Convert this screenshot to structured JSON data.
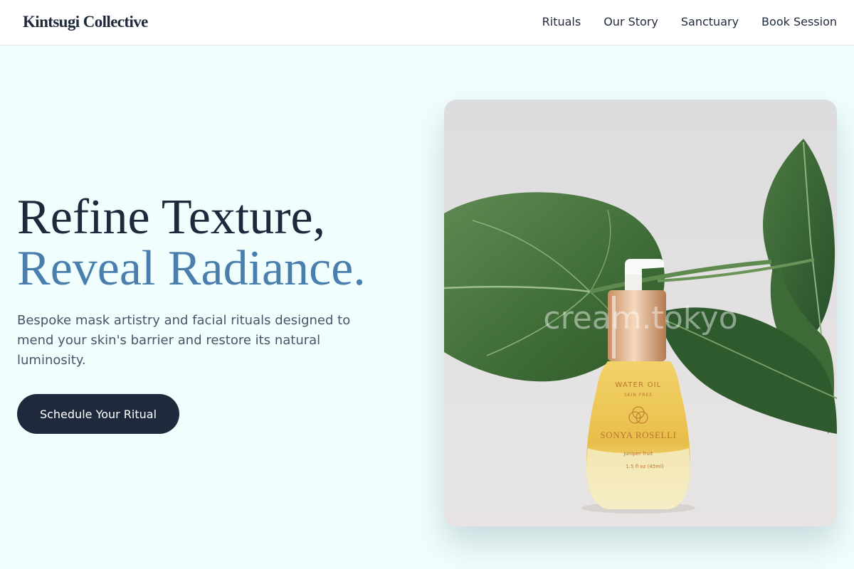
{
  "brand": {
    "name": "Kintsugi Collective"
  },
  "nav": {
    "items": [
      {
        "label": "Rituals"
      },
      {
        "label": "Our Story"
      },
      {
        "label": "Sanctuary"
      },
      {
        "label": "Book Session"
      }
    ]
  },
  "hero": {
    "title_line1": "Refine Texture,",
    "title_line2": "Reveal Radiance.",
    "subtitle": "Bespoke mask artistry and facial rituals designed to mend your skin's barrier and restore its natural luminosity.",
    "cta_label": "Schedule Your Ritual"
  },
  "product_image": {
    "watermark": "cream.tokyo",
    "bottle_label_line1": "WATER OIL",
    "bottle_label_line2": "SKIN FREE",
    "bottle_brand": "SONYA ROSELLI",
    "bottle_label_line3": "juniper fruit",
    "bottle_volume": "1.5 fl oz (45ml)"
  },
  "colors": {
    "page_background": "#f0fefe",
    "heading": "#1e293b",
    "accent_heading": "#4a7fad",
    "body_text": "#475569",
    "cta_background": "#1e293b",
    "cta_text": "#ffffff"
  }
}
